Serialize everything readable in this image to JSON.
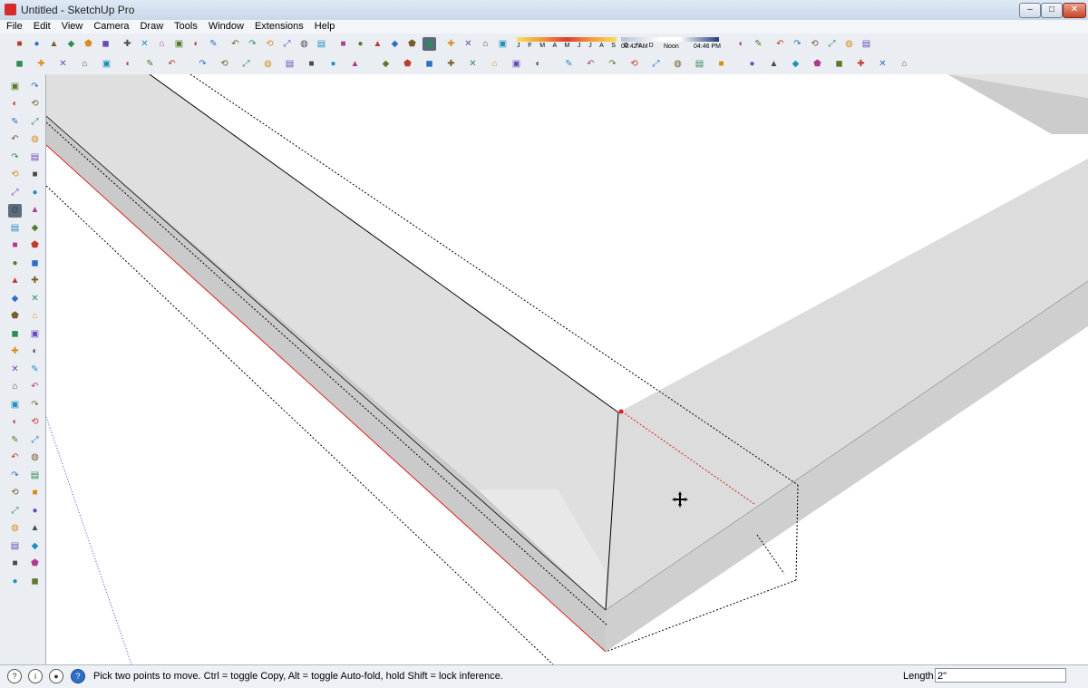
{
  "window": {
    "title": "Untitled - SketchUp Pro",
    "controls": {
      "minimize": "–",
      "maximize": "□",
      "close": "✕"
    }
  },
  "menus": [
    "File",
    "Edit",
    "View",
    "Camera",
    "Draw",
    "Tools",
    "Window",
    "Extensions",
    "Help"
  ],
  "shadow_settings": {
    "months_label": "J F M A M J J A S O N D",
    "time_start": "06:42 AM",
    "time_mid": "Noon",
    "time_end": "04:46 PM"
  },
  "toolbar1_icons": [
    "new-file-icon",
    "open-file-icon",
    "save-icon",
    "cut-icon",
    "copy-icon",
    "paste-icon",
    "erase-icon",
    "undo-icon",
    "redo-icon",
    "print-icon",
    "model-info-icon",
    "iso-view-icon",
    "top-view-icon",
    "front-view-icon",
    "right-view-icon",
    "back-view-icon",
    "left-view-icon",
    "xray-icon",
    "back-edges-icon",
    "wireframe-icon",
    "hidden-line-icon",
    "shaded-icon",
    "shaded-textures-icon",
    "monochrome-icon",
    "shadows-icon",
    "fog-icon",
    "section-plane-icon",
    "style-builder-icon",
    "sandbox-icon",
    "dynamic-component-icon",
    "warehouse-icon",
    "extension-icon",
    "layout-icon",
    "solid-tools-icon",
    "geo-location-icon",
    "advanced-camera-icon"
  ],
  "toolbar2_icons": [
    "line-icon",
    "freehand-icon",
    "arc-icon",
    "two-point-arc-icon",
    "pie-icon",
    "circle-icon",
    "polygon-icon",
    "rectangle-icon",
    "rotated-rect-icon",
    "bezier-icon",
    "spline-icon",
    "offset-icon",
    "followme-icon",
    "pushpull-icon",
    "intersect-icon",
    "union-icon",
    "subtract-icon",
    "trim-icon",
    "split-icon",
    "outer-shell-icon",
    "dimension-icon",
    "text-icon",
    "axes-icon",
    "help-icon",
    "terrain-icon",
    "smoove-icon",
    "stamp-icon",
    "drape-icon",
    "add-detail-icon",
    "flip-edge-icon",
    "scale-icon",
    "rotate-icon",
    "move-icon",
    "align-icon",
    "flip-icon",
    "mirror-icon",
    "weld-icon",
    "selection-icon",
    "fillet-icon",
    "chamfer-icon"
  ],
  "left_tools_col1": [
    "select-icon",
    "paint-bucket-icon",
    "pencil-icon",
    "rectangle-icon",
    "circle-icon",
    "arc-icon",
    "spiral-icon",
    "move-icon",
    "rotate-icon",
    "scale-icon",
    "tape-measure-icon",
    "protractor-icon",
    "zoom-icon",
    "zoom-extents-icon",
    "orbit-icon",
    "pan-icon",
    "walk-icon",
    "look-around-icon",
    "position-camera-icon",
    "section-icon",
    "dims-icon",
    "axes-icon",
    "paint-icon",
    "geo-icon",
    "sandbox-icon",
    "component-icon",
    "warehouse-icon",
    "generic-icon",
    "model-icon"
  ],
  "left_tools_col2": [
    "eraser-icon",
    "freehand-icon",
    "rotated-rect-icon",
    "polygon-icon",
    "two-point-arc-icon",
    "pie-icon",
    "push-pull-icon",
    "follow-me-icon",
    "offset-icon",
    "text-icon",
    "dimension-icon",
    "3d-text-icon",
    "orbit-icon",
    "look-around-icon",
    "flip-icon",
    "align-icon",
    "make-component-icon",
    "roof-icon",
    "door-icon",
    "window-icon",
    "stairs-icon",
    "wall-icon",
    "layer-icon",
    "outliner-icon",
    "materials-icon",
    "scenes-icon",
    "shadow-icon",
    "style-icon",
    "sketch-icon"
  ],
  "status": {
    "icons": [
      "geo-location-icon",
      "credits-icon",
      "user-icon",
      "help-icon"
    ],
    "message": "Pick two points to move.  Ctrl = toggle Copy, Alt = toggle Auto-fold, hold Shift = lock inference.",
    "measure_label": "Length",
    "measure_value": "2\""
  },
  "colors": {
    "face_light": "#e3e3e3",
    "face_mid": "#dadada",
    "face_dark": "#cbcbcb",
    "edge": "#000000",
    "red_axis": "#e01e1e",
    "blue_axis": "#3a4bd8"
  }
}
